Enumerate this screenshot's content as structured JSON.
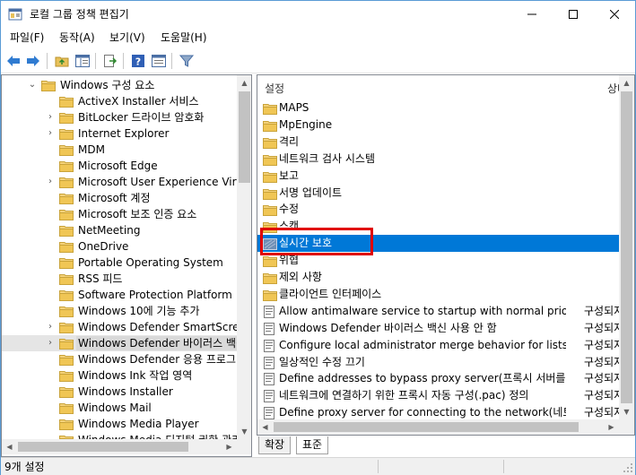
{
  "window": {
    "title": "로컬 그룹 정책 편집기"
  },
  "menu": [
    "파일(F)",
    "동작(A)",
    "보기(V)",
    "도움말(H)"
  ],
  "toolbar": {
    "buttons": [
      "back-icon",
      "forward-icon",
      "up-folder-icon",
      "show-hide-tree-icon",
      "export-list-icon",
      "help-icon",
      "properties-icon",
      "filter-icon"
    ]
  },
  "tree": {
    "items": [
      {
        "label": "Windows 구성 요소",
        "expander": "⌄",
        "indent": 0
      },
      {
        "label": "ActiveX Installer 서비스",
        "expander": "",
        "indent": 1
      },
      {
        "label": "BitLocker 드라이브 암호화",
        "expander": "›",
        "indent": 1
      },
      {
        "label": "Internet Explorer",
        "expander": "›",
        "indent": 1
      },
      {
        "label": "MDM",
        "expander": "",
        "indent": 1
      },
      {
        "label": "Microsoft Edge",
        "expander": "",
        "indent": 1
      },
      {
        "label": "Microsoft User Experience Virtual",
        "expander": "›",
        "indent": 1
      },
      {
        "label": "Microsoft 계정",
        "expander": "",
        "indent": 1
      },
      {
        "label": "Microsoft 보조 인증 요소",
        "expander": "",
        "indent": 1
      },
      {
        "label": "NetMeeting",
        "expander": "",
        "indent": 1
      },
      {
        "label": "OneDrive",
        "expander": "",
        "indent": 1
      },
      {
        "label": "Portable Operating System",
        "expander": "",
        "indent": 1
      },
      {
        "label": "RSS 피드",
        "expander": "",
        "indent": 1
      },
      {
        "label": "Software Protection Platform",
        "expander": "",
        "indent": 1
      },
      {
        "label": "Windows 10에 기능 추가",
        "expander": "",
        "indent": 1
      },
      {
        "label": "Windows Defender SmartScreen",
        "expander": "›",
        "indent": 1
      },
      {
        "label": "Windows Defender 바이러스 백신",
        "expander": "›",
        "indent": 1,
        "selected": true
      },
      {
        "label": "Windows Defender 응용 프로그램",
        "expander": "",
        "indent": 1
      },
      {
        "label": "Windows Ink 작업 영역",
        "expander": "",
        "indent": 1
      },
      {
        "label": "Windows Installer",
        "expander": "",
        "indent": 1
      },
      {
        "label": "Windows Mail",
        "expander": "",
        "indent": 1
      },
      {
        "label": "Windows Media Player",
        "expander": "",
        "indent": 1
      },
      {
        "label": "Windows Media 디지털 권한 관리",
        "expander": "",
        "indent": 1
      }
    ]
  },
  "list": {
    "columns": [
      "설정",
      "상태"
    ],
    "items": [
      {
        "type": "folder",
        "name": "MAPS",
        "state": ""
      },
      {
        "type": "folder",
        "name": "MpEngine",
        "state": ""
      },
      {
        "type": "folder",
        "name": "격리",
        "state": ""
      },
      {
        "type": "folder",
        "name": "네트워크 검사 시스템",
        "state": ""
      },
      {
        "type": "folder",
        "name": "보고",
        "state": ""
      },
      {
        "type": "folder",
        "name": "서명 업데이트",
        "state": ""
      },
      {
        "type": "folder",
        "name": "수정",
        "state": ""
      },
      {
        "type": "folder",
        "name": "스캔",
        "state": ""
      },
      {
        "type": "folder",
        "name": "실시간 보호",
        "state": "",
        "selected": true
      },
      {
        "type": "folder",
        "name": "위협",
        "state": ""
      },
      {
        "type": "folder",
        "name": "제외 사항",
        "state": ""
      },
      {
        "type": "folder",
        "name": "클라이언트 인터페이스",
        "state": ""
      },
      {
        "type": "setting",
        "name": "Allow antimalware service to startup with normal priority(...",
        "state": "구성되지"
      },
      {
        "type": "setting",
        "name": "Windows Defender 바이러스 백신 사용 안 함",
        "state": "구성되지"
      },
      {
        "type": "setting",
        "name": "Configure local administrator merge behavior for lists(로컬...",
        "state": "구성되지"
      },
      {
        "type": "setting",
        "name": "일상적인 수정 끄기",
        "state": "구성되지"
      },
      {
        "type": "setting",
        "name": "Define addresses to bypass proxy server(프록시 서버를 사...",
        "state": "구성되지"
      },
      {
        "type": "setting",
        "name": "네트워크에 연결하기 위한 프록시 자동 구성(.pac) 정의",
        "state": "구성되지"
      },
      {
        "type": "setting",
        "name": "Define proxy server for connecting to the network(네트워...",
        "state": "구성되지"
      }
    ]
  },
  "tabs": [
    "확장",
    "표준"
  ],
  "status": {
    "text": "9개 설정"
  },
  "colors": {
    "selection": "#0078d7",
    "highlight_box": "#e00000",
    "folder": "#e8c15a"
  }
}
